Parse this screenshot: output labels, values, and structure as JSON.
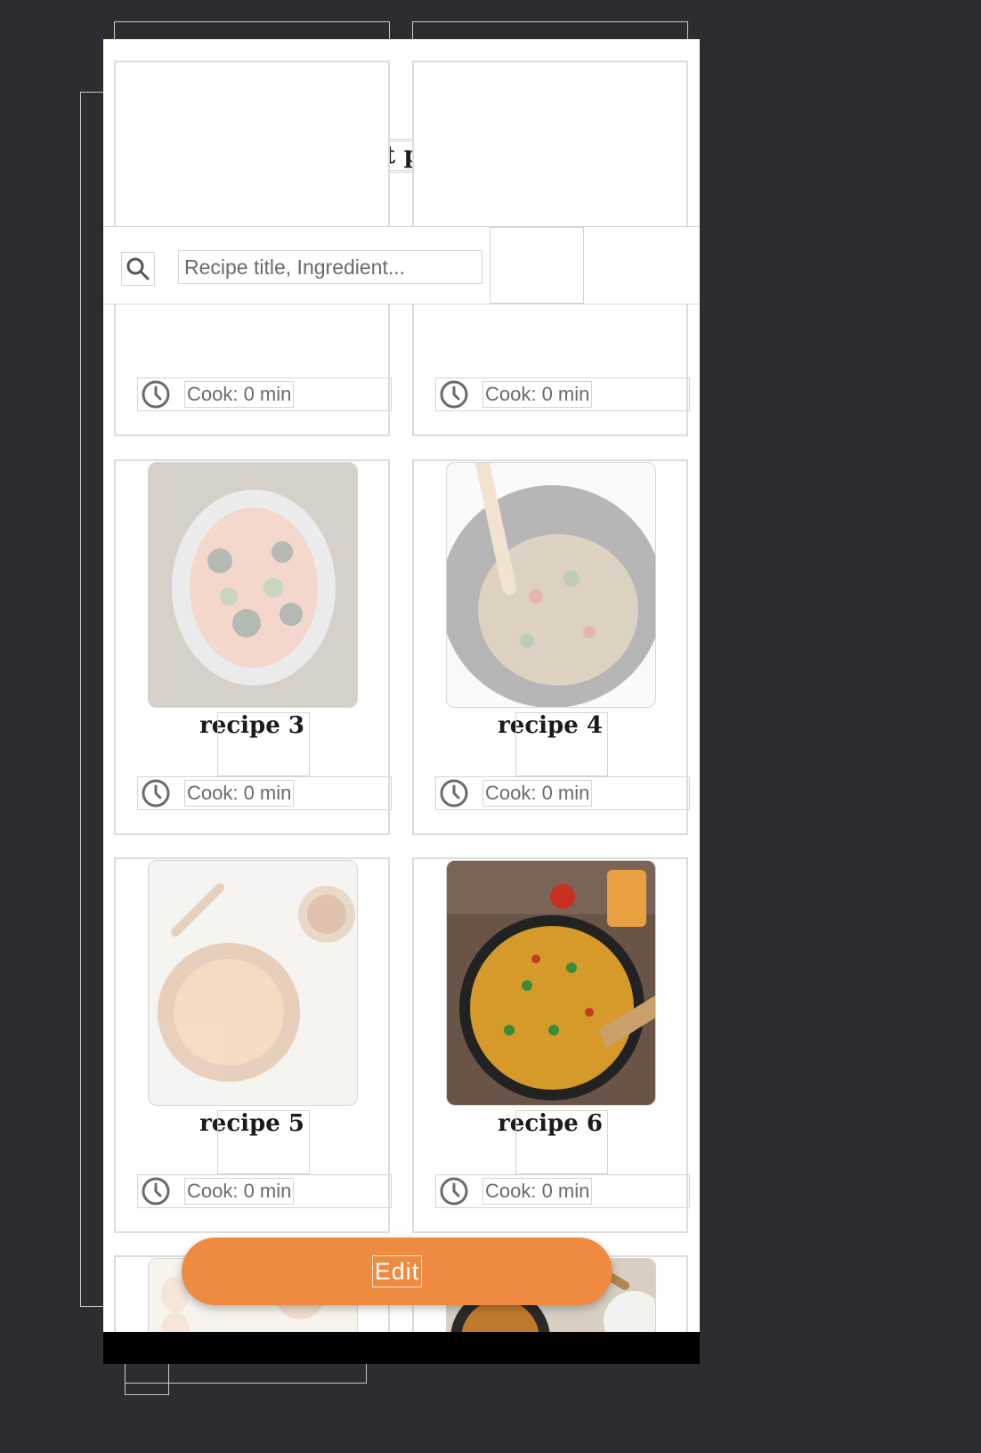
{
  "header": {
    "title": "Edit plan"
  },
  "search": {
    "placeholder": "Recipe title, Ingredient..."
  },
  "recipes": [
    {
      "title": "",
      "cook_label": "Cook: 0 min"
    },
    {
      "title": "",
      "cook_label": "Cook: 0 min"
    },
    {
      "title": "recipe 3",
      "cook_label": "Cook: 0 min"
    },
    {
      "title": "recipe 4",
      "cook_label": "Cook: 0 min"
    },
    {
      "title": "recipe 5",
      "cook_label": "Cook: 0 min"
    },
    {
      "title": "recipe 6",
      "cook_label": "Cook: 0 min"
    },
    {
      "title": "",
      "cook_label": ""
    },
    {
      "title": "",
      "cook_label": ""
    }
  ],
  "actions": {
    "edit_label": "Edit"
  },
  "colors": {
    "accent": "#ee8b40",
    "background": "#2c2d31",
    "text_muted": "#6b6b6b",
    "border": "#d5d5d5"
  }
}
